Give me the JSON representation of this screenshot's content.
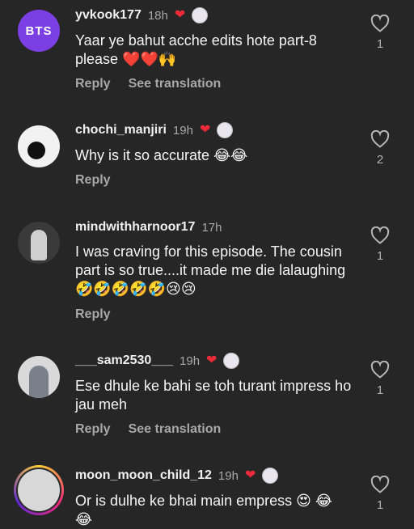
{
  "comments": [
    {
      "avatar_text": "BTS",
      "username": "yvkook177",
      "time": "18h",
      "text": "Yaar ye bahut acche edits hote part-8 please ❤️❤️🙌",
      "reply": "Reply",
      "translate": "See translation",
      "likes": "1"
    },
    {
      "username": "chochi_manjiri",
      "time": "19h",
      "text": "Why is it so accurate 😂😂",
      "reply": "Reply",
      "likes": "2"
    },
    {
      "username": "mindwithharnoor17",
      "time": "17h",
      "text": "I was craving for this episode. The cousin part is so true....it made me die lalaughing 🤣🤣🤣🤣🤣😢😢",
      "reply": "Reply",
      "likes": "1"
    },
    {
      "username": "___sam2530___",
      "time": "19h",
      "text": "Ese dhule ke bahi se toh turant impress ho jau meh",
      "reply": "Reply",
      "translate": "See translation",
      "likes": "1"
    },
    {
      "username": "moon_moon_child_12",
      "time": "19h",
      "text": "Or is dulhe ke bhai main empress 😍 😂😂",
      "likes": "1"
    }
  ],
  "icons": {
    "heart": "heart-outline-icon",
    "creator_liked": "red-heart-icon"
  },
  "colors": {
    "background": "#262626",
    "creator_heart": "#ed2a3a",
    "muted_text": "#a8a8a8"
  }
}
